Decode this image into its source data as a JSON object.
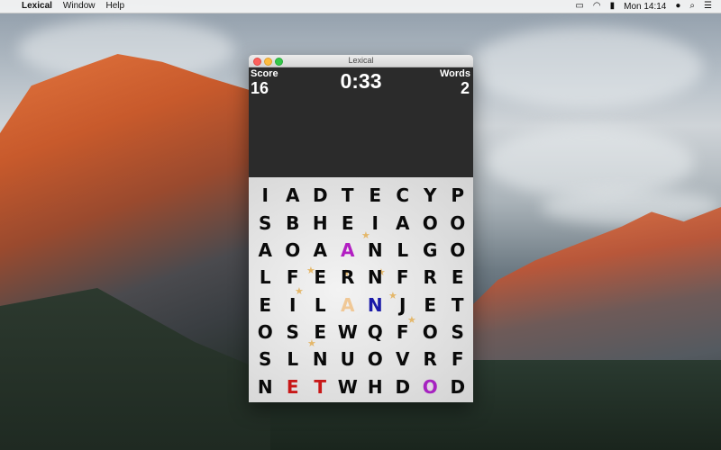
{
  "menubar": {
    "app_name": "Lexical",
    "menus": [
      "Window",
      "Help"
    ],
    "clock": "Mon 14:14"
  },
  "window": {
    "title": "Lexical"
  },
  "hud": {
    "score_label": "Score",
    "score_value": "16",
    "words_label": "Words",
    "words_value": "2",
    "timer": "0:33"
  },
  "board": {
    "rows": [
      [
        {
          "l": "I"
        },
        {
          "l": "A"
        },
        {
          "l": "D"
        },
        {
          "l": "T"
        },
        {
          "l": "E"
        },
        {
          "l": "C"
        },
        {
          "l": "Y"
        },
        {
          "l": "P"
        }
      ],
      [
        {
          "l": "S"
        },
        {
          "l": "B"
        },
        {
          "l": "H"
        },
        {
          "l": "E"
        },
        {
          "l": "I"
        },
        {
          "l": "A"
        },
        {
          "l": "O"
        },
        {
          "l": "O"
        }
      ],
      [
        {
          "l": "A"
        },
        {
          "l": "O"
        },
        {
          "l": "A"
        },
        {
          "l": "A",
          "c": "#b21fc2"
        },
        {
          "l": "N"
        },
        {
          "l": "L"
        },
        {
          "l": "G"
        },
        {
          "l": "O"
        }
      ],
      [
        {
          "l": "L"
        },
        {
          "l": "F"
        },
        {
          "l": "E"
        },
        {
          "l": "R"
        },
        {
          "l": "N"
        },
        {
          "l": "F"
        },
        {
          "l": "R"
        },
        {
          "l": "E"
        }
      ],
      [
        {
          "l": "E"
        },
        {
          "l": "I"
        },
        {
          "l": "L"
        },
        {
          "l": "A",
          "c": "#f0c896"
        },
        {
          "l": "N",
          "c": "#1a1aa8"
        },
        {
          "l": "J"
        },
        {
          "l": "E"
        },
        {
          "l": "T"
        }
      ],
      [
        {
          "l": "O"
        },
        {
          "l": "S"
        },
        {
          "l": "E"
        },
        {
          "l": "W"
        },
        {
          "l": "Q"
        },
        {
          "l": "F"
        },
        {
          "l": "O"
        },
        {
          "l": "S"
        }
      ],
      [
        {
          "l": "S"
        },
        {
          "l": "L"
        },
        {
          "l": "N"
        },
        {
          "l": "U"
        },
        {
          "l": "O"
        },
        {
          "l": "V"
        },
        {
          "l": "R"
        },
        {
          "l": "F"
        }
      ],
      [
        {
          "l": "N"
        },
        {
          "l": "E",
          "c": "#c81818"
        },
        {
          "l": "T",
          "c": "#c81818"
        },
        {
          "l": "W"
        },
        {
          "l": "H"
        },
        {
          "l": "D"
        },
        {
          "l": "O",
          "c": "#a622c0",
          "badge": true
        },
        {
          "l": "D"
        }
      ]
    ]
  }
}
